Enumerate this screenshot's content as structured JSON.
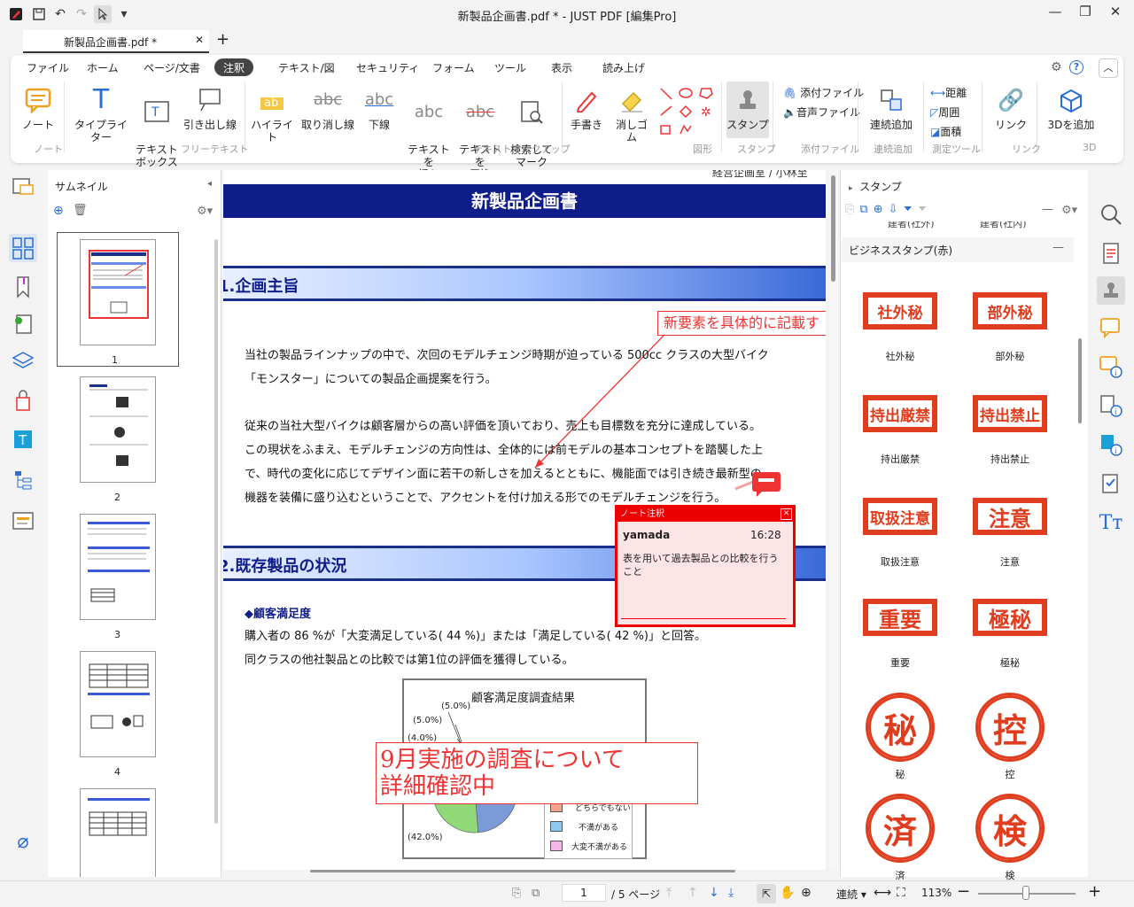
{
  "window": {
    "title": "新製品企画書.pdf * - JUST PDF [編集Pro]",
    "tab_label": "新製品企画書.pdf *"
  },
  "menu": [
    "ファイル",
    "ホーム",
    "ページ/文書",
    "注釈",
    "テキスト/図",
    "セキュリティ",
    "フォーム",
    "ツール",
    "表示",
    "読み上げ"
  ],
  "ribbon": {
    "note": "ノート",
    "typewriter": "タイプライター",
    "textbox": "テキスト\nボックス",
    "callout": "引き出し線",
    "highlight": "ハイライト",
    "strike": "取り消し線",
    "underline": "下線",
    "insert_text": "テキストを\n挿入",
    "replace_text": "テキストを\n置換",
    "search_mark": "検索して\nマーク",
    "pen": "手書き",
    "eraser": "消しゴム",
    "stamp": "スタンプ",
    "attach_file": "添付ファイル",
    "attach_sound": "音声ファイル",
    "add_link_cont": "連続追加",
    "distance": "距離",
    "perimeter": "周囲",
    "area": "面積",
    "link": "リンク",
    "add3d": "3Dを追加",
    "groups": {
      "note": "ノート",
      "freetext": "フリーテキスト",
      "textmarkup": "テキストマークアップ",
      "shapes": "図形",
      "stamp": "スタンプ",
      "attach": "添付ファイル",
      "cont": "連続追加",
      "measure": "測定ツール",
      "link": "リンク",
      "g3d": "3D"
    }
  },
  "thumbnails": {
    "title": "サムネイル",
    "pages": [
      "1",
      "2",
      "3",
      "4"
    ]
  },
  "document": {
    "header_cut": "経営企画室 / 小林至",
    "title": "新製品企画書",
    "sec1": "1.企画主旨",
    "callout": "新要素を具体的に記載す",
    "p1": [
      "当社の製品ラインナップの中で、次回のモデルチェンジ時期が迫っている 500cc クラスの大型バイク",
      "「モンスター」についての製品企画提案を行う。"
    ],
    "p2": [
      "従来の当社大型バイクは顧客層からの高い評価を頂いており、売上も目標数を充分に達成している。",
      "この現状をふまえ、モデルチェンジの方向性は、全体的には前モデルの基本コンセプトを踏襲した上",
      "で、時代の変化に応じてデザイン面に若干の新しさを加えるとともに、機能面では引き続き最新型の",
      "機器を装備に盛り込むということで、アクセントを付け加える形でのモデルチェンジを行う。"
    ],
    "sec2": "2.既存製品の状況",
    "sub": "◆顧客満足度",
    "p3": [
      "購入者の 86 %が「大変満足している( 44 %)」または「満足している( 42 %)」と回答。",
      "同クラスの他社製品との比較では第1位の評価を獲得している。"
    ],
    "note_popup": {
      "header": "ノート注釈",
      "user": "yamada",
      "time": "16:28",
      "text": "表を用いて過去製品との比較を行うこと"
    },
    "chart_title": "顧客満足度調査結果",
    "freetext": [
      "9月実施の調査について",
      "詳細確認中"
    ]
  },
  "chart_data": {
    "type": "pie",
    "title": "顧客満足度調査結果",
    "labels_visible": [
      "(5.0%)",
      "(5.0%)",
      "(4.0%)",
      "(42.0%)"
    ],
    "legend": [
      "どちらでもない",
      "不満がある",
      "大変不満がある"
    ],
    "legend_colors": [
      "#f4a48c",
      "#8cc8f0",
      "#f4b8e8"
    ]
  },
  "stamps": {
    "panel_title": "スタンプ",
    "category": "ビジネススタンプ(赤)",
    "items": [
      {
        "text": "社外秘",
        "label": "社外秘"
      },
      {
        "text": "部外秘",
        "label": "部外秘"
      },
      {
        "text": "持出厳禁",
        "label": "持出厳禁"
      },
      {
        "text": "持出禁止",
        "label": "持出禁止"
      },
      {
        "text": "取扱注意",
        "label": "取扱注意"
      },
      {
        "text": "注意",
        "label": "注意"
      },
      {
        "text": "重要",
        "label": "重要"
      },
      {
        "text": "極秘",
        "label": "極秘"
      },
      {
        "text": "秘",
        "label": "秘"
      },
      {
        "text": "控",
        "label": "控"
      },
      {
        "text": "済",
        "label": "済"
      },
      {
        "text": "検",
        "label": "検"
      }
    ],
    "cut_labels": [
      "建者(社外)",
      "建者(社内)"
    ]
  },
  "status": {
    "page": "1",
    "total": "/ 5 ページ",
    "mode": "連続",
    "zoom": "113%"
  }
}
